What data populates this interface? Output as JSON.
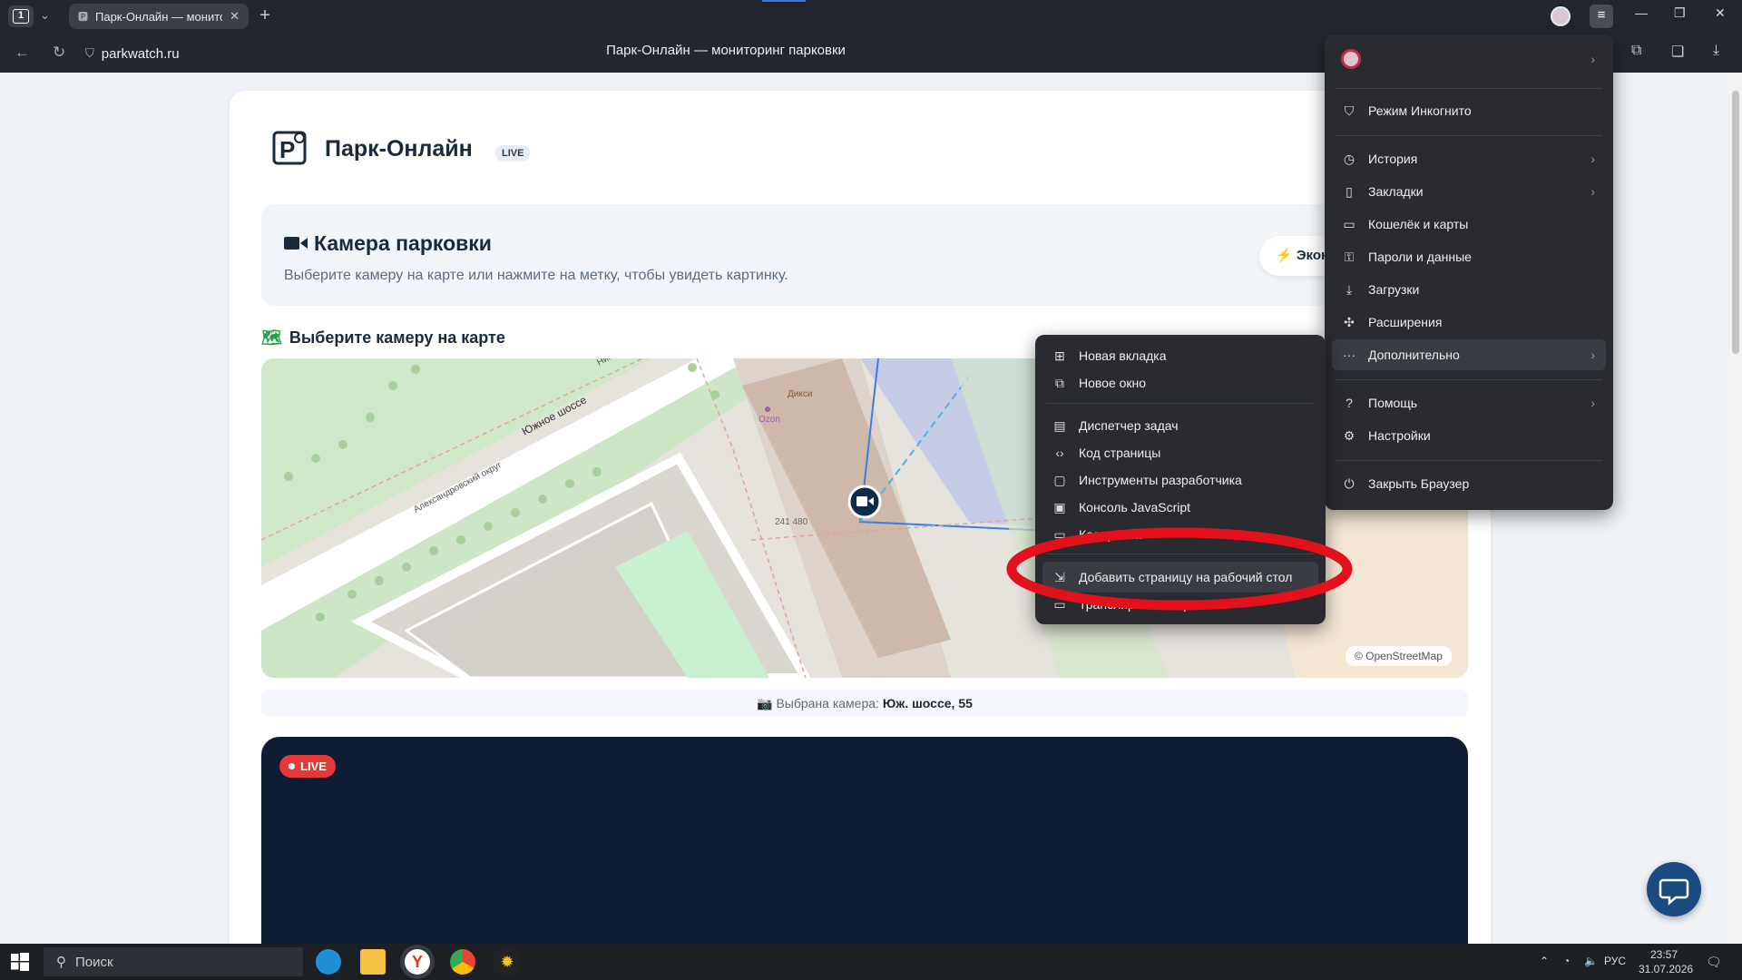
{
  "browser": {
    "tab_count": "1",
    "tab_title": "Парк-Онлайн — мониторинг парковки",
    "url": "parkwatch.ru",
    "page_title": "Парк-Онлайн — мониторинг парковки"
  },
  "site": {
    "brand": "Парк-Онлайн",
    "live_badge": "LIVE",
    "hero_title": "Камера парковки",
    "hero_text": "Выберите камеру на карте или нажмите на метку, чтобы увидеть картинку.",
    "econ_button": "Экон",
    "map_section_title": "Выберите камеру на карте",
    "osm_credit": "© OpenStreetMap",
    "selected_label": "Выбрана камера:",
    "selected_value": "Юж. шоссе, 55",
    "live_pill": "LIVE"
  },
  "map": {
    "labels": {
      "street1": "Южное шоссе",
      "street2": "Александровский округ",
      "street_short": "Ник",
      "shop1": "Дикси",
      "shop2": "Ozon",
      "house": "241 480"
    }
  },
  "main_menu": {
    "items": [
      {
        "label": "Режим Инкогнито",
        "icon": "shield-icon"
      },
      {
        "label": "История",
        "icon": "clock-icon"
      },
      {
        "label": "Закладки",
        "icon": "bookmark-icon"
      },
      {
        "label": "Кошелёк и карты",
        "icon": "wallet-icon"
      },
      {
        "label": "Пароли и данные",
        "icon": "key-icon"
      },
      {
        "label": "Загрузки",
        "icon": "download-icon"
      },
      {
        "label": "Расширения",
        "icon": "puzzle-icon"
      },
      {
        "label": "Дополнительно",
        "icon": "more-icon"
      },
      {
        "label": "Помощь",
        "icon": "help-icon"
      },
      {
        "label": "Настройки",
        "icon": "gear-icon"
      },
      {
        "label": "Закрыть Браузер",
        "icon": "power-icon"
      }
    ]
  },
  "sub_menu": {
    "items": [
      {
        "label": "Новая вкладка",
        "icon": "plus-square-icon"
      },
      {
        "label": "Новое окно",
        "icon": "new-window-icon"
      },
      {
        "label": "Диспетчер задач",
        "icon": "task-manager-icon"
      },
      {
        "label": "Код страницы",
        "icon": "code-icon"
      },
      {
        "label": "Инструменты разработчика",
        "icon": "devtools-icon"
      },
      {
        "label": "Консоль JavaScript",
        "icon": "console-icon"
      },
      {
        "label": "Кодировка",
        "icon": "encoding-icon"
      },
      {
        "label": "Добавить страницу на рабочий стол",
        "icon": "add-to-desktop-icon"
      },
      {
        "label": "Транслировать экран",
        "icon": "cast-icon"
      }
    ]
  },
  "annotation": {
    "color": "#e3111b"
  },
  "taskbar": {
    "search_placeholder": "Поиск",
    "lang": "РУС",
    "time": "23:57",
    "date": "31.07.2026"
  }
}
